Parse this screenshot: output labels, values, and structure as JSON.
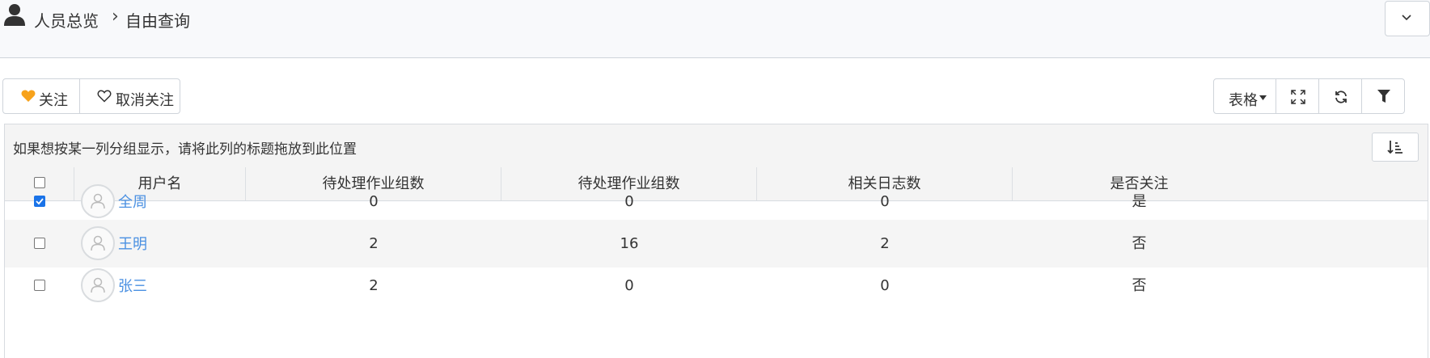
{
  "breadcrumb": {
    "root": "人员总览",
    "current": "自由查询"
  },
  "toolbar": {
    "follow_label": "关注",
    "unfollow_label": "取消关注",
    "view_label": "表格"
  },
  "colors": {
    "link": "#4a90e2",
    "heart": "#f7a21b",
    "checkbox": "#1a73e8"
  },
  "grid": {
    "group_hint": "如果想按某一列分组显示，请将此列的标题拖放到此位置",
    "columns": [
      "用户名",
      "待处理作业组数",
      "待处理作业组数",
      "相关日志数",
      "是否关注"
    ],
    "rows": [
      {
        "checked": true,
        "name": "全周",
        "c1": "0",
        "c2": "0",
        "c3": "0",
        "followed": "是"
      },
      {
        "checked": false,
        "name": "王明",
        "c1": "2",
        "c2": "16",
        "c3": "2",
        "followed": "否"
      },
      {
        "checked": false,
        "name": "张三",
        "c1": "2",
        "c2": "0",
        "c3": "0",
        "followed": "否"
      }
    ]
  }
}
